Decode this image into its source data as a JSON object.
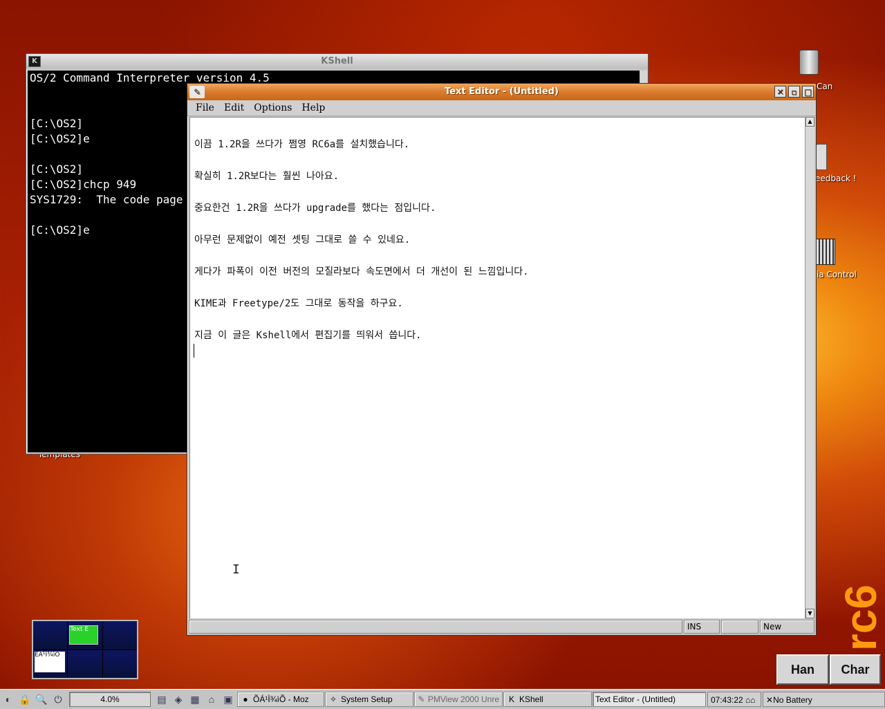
{
  "desktop": {
    "icons": {
      "trash_label": "Can",
      "feedback_label": "eedback !",
      "media_label": "ia Control",
      "templates_label": "Templates"
    },
    "brand": "rc6"
  },
  "kshell": {
    "title": "KShell",
    "lines": [
      "OS/2 Command Interpreter version 4.5",
      "",
      "",
      "[C:\\OS2]",
      "[C:\\OS2]e",
      "",
      "[C:\\OS2]",
      "[C:\\OS2]chcp 949",
      "SYS1729:  The code page",
      "",
      "[C:\\OS2]e"
    ]
  },
  "editor": {
    "title": "Text Editor - (Untitled)",
    "menu": [
      "File",
      "Edit",
      "Options",
      "Help"
    ],
    "lines": [
      "이끔 1.2R을 쓰다가 쩜영 RC6a를 설치했습니다.",
      "확실히 1.2R보다는 훨씬 나아요.",
      "중요한건 1.2R을 쓰다가 upgrade를 했다는 점입니다.",
      "아무런 문제없이 예전 셋팅 그대로 쓸 수 있네요.",
      "게다가 파폭이 이전 버전의 모질라보다 속도면에서 더 개선이 된 느낌입니다.",
      "KIME과 Freetype/2도 그대로 동작을 하구요.",
      "지금 이 글은 Kshell에서 편집기를 띄워서 씁니다."
    ],
    "status": {
      "mode": "INS",
      "state": "New"
    }
  },
  "pager": {
    "thumb_label": "Text E",
    "thumb2_label": "ÈÁ¹Ì¾ìÕ"
  },
  "ime": {
    "han": "Han",
    "char": "Char"
  },
  "taskbar": {
    "cpu": "4.0%",
    "tasks": [
      "ÕÁ¹Ì¾ìÕ - Moz",
      "System Setup",
      "PMView 2000 Unre",
      "KShell",
      "Text Editor - (Untitled)"
    ],
    "clock": "07:43:22",
    "battery": "No Battery"
  }
}
